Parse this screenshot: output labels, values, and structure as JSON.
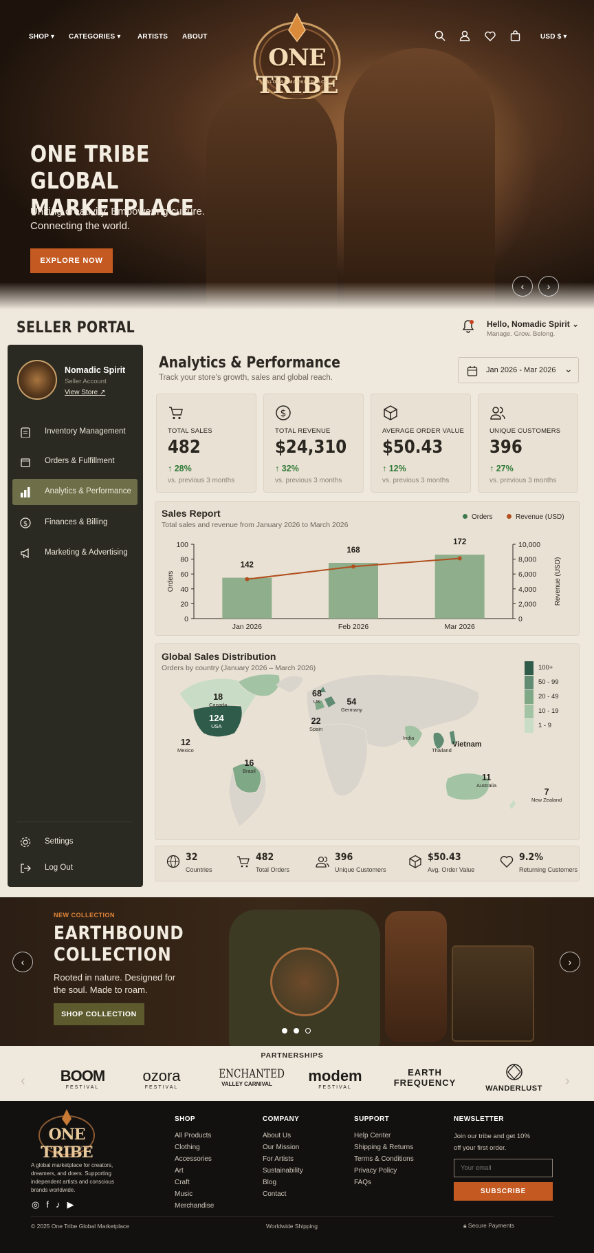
{
  "nav": {
    "shop": "SHOP",
    "categories": "CATEGORIES",
    "artists": "ARTISTS",
    "about": "ABOUT",
    "currency": "USD $"
  },
  "brand": {
    "logo_text": "ONE TRIBE",
    "logo_sub": "GLOBAL MARKETPLACE"
  },
  "hero": {
    "title_line1": "ONE TRIBE",
    "title_line2": "GLOBAL MARKETPLACE",
    "subtitle_line1": "Uniting creativity. Empowering culture.",
    "subtitle_line2": "Connecting the world.",
    "cta": "EXPLORE NOW"
  },
  "portal": {
    "title": "SELLER PORTAL",
    "greeting": "Hello, Nomadic Spirit",
    "tagline": "Manage. Grow. Belong."
  },
  "sidebar": {
    "profile": {
      "name": "Nomadic Spirit",
      "role": "Seller Account",
      "link": "View Store"
    },
    "items": [
      {
        "label": "Inventory Management",
        "icon": "clipboard-icon"
      },
      {
        "label": "Orders & Fulfillment",
        "icon": "box-icon"
      },
      {
        "label": "Analytics & Performance",
        "icon": "bar-chart-icon",
        "active": true
      },
      {
        "label": "Finances & Billing",
        "icon": "dollar-icon"
      },
      {
        "label": "Marketing & Advertising",
        "icon": "megaphone-icon"
      }
    ],
    "settings": "Settings",
    "logout": "Log Out"
  },
  "analytics": {
    "title": "Analytics & Performance",
    "subtitle": "Track your store's growth, sales and global reach.",
    "date_range": "Jan 2026 - Mar 2026",
    "stats": [
      {
        "label": "TOTAL SALES",
        "value": "482",
        "change": "28%",
        "compare": "vs. previous 3 months",
        "icon": "cart-icon"
      },
      {
        "label": "TOTAL REVENUE",
        "value": "$24,310",
        "change": "32%",
        "compare": "vs. previous 3 months",
        "icon": "dollar-icon"
      },
      {
        "label": "AVERAGE ORDER VALUE",
        "value": "$50.43",
        "change": "12%",
        "compare": "vs. previous 3 months",
        "icon": "package-icon"
      },
      {
        "label": "UNIQUE CUSTOMERS",
        "value": "396",
        "change": "27%",
        "compare": "vs. previous 3 months",
        "icon": "users-icon"
      }
    ]
  },
  "chart_data": {
    "type": "bar",
    "title": "Sales Report",
    "subtitle": "Total sales and revenue from January 2026 to March 2026",
    "categories": [
      "Jan 2026",
      "Feb 2026",
      "Mar 2026"
    ],
    "series": [
      {
        "name": "Orders",
        "type": "bar",
        "axis": "left",
        "values": [
          55,
          75,
          86
        ],
        "labels": [
          "142",
          "168",
          "172"
        ],
        "color": "#8fae8c"
      },
      {
        "name": "Revenue (USD)",
        "type": "line",
        "axis": "right",
        "values": [
          5300,
          7000,
          8100
        ],
        "color": "#b14f1e"
      }
    ],
    "ylabel": "Orders",
    "y2label": "Revenue (USD)",
    "ylim": [
      0,
      100
    ],
    "y2lim": [
      0,
      10000
    ],
    "yticks": [
      "0",
      "20",
      "40",
      "60",
      "80",
      "100"
    ],
    "y2ticks": [
      "0",
      "2,000",
      "4,000",
      "6,000",
      "8,000",
      "10,000"
    ],
    "legend": "top-right"
  },
  "map": {
    "title": "Global Sales Distribution",
    "subtitle": "Orders by country (January 2026 – March 2026)",
    "legend": [
      "100+",
      "50 - 99",
      "20 - 49",
      "10 - 19",
      "1 - 9"
    ],
    "legend_colors": [
      "#2f5b4b",
      "#5f8c73",
      "#7fa887",
      "#a3c3a5",
      "#c9dcc6"
    ],
    "countries": [
      {
        "value": "18",
        "name": "Canada"
      },
      {
        "value": "124",
        "name": "USA"
      },
      {
        "value": "12",
        "name": "Mexico"
      },
      {
        "value": "16",
        "name": "Brasil"
      },
      {
        "value": "68",
        "name": "UK"
      },
      {
        "value": "54",
        "name": "Germany"
      },
      {
        "value": "22",
        "name": "Spain"
      },
      {
        "value": "",
        "name": "India"
      },
      {
        "value": "",
        "name": "Thailand"
      },
      {
        "value": "",
        "name": "Vietnam"
      },
      {
        "value": "11",
        "name": "Australia"
      },
      {
        "value": "7",
        "name": "New Zealand"
      }
    ]
  },
  "summary": [
    {
      "value": "32",
      "label": "Countries",
      "icon": "globe-icon"
    },
    {
      "value": "482",
      "label": "Total Orders",
      "icon": "cart-icon"
    },
    {
      "value": "396",
      "label": "Unique Customers",
      "icon": "users-icon"
    },
    {
      "value": "$50.43",
      "label": "Avg. Order Value",
      "icon": "package-icon"
    },
    {
      "value": "9.2%",
      "label": "Returning Customers",
      "icon": "heart-icon"
    }
  ],
  "collection": {
    "tag": "NEW COLLECTION",
    "title_line1": "EARTHBOUND",
    "title_line2": "COLLECTION",
    "desc_line1": "Rooted in nature. Designed for",
    "desc_line2": "the soul. Made to roam.",
    "cta": "SHOP COLLECTION"
  },
  "partnerships": {
    "title": "PARTNERSHIPS",
    "logos": [
      {
        "main": "BOOM",
        "sub": "FESTIVAL"
      },
      {
        "main": "ozora",
        "sub": "FESTIVAL"
      },
      {
        "main": "ENCHANTED",
        "sub": "VALLEY CARNIVAL"
      },
      {
        "main": "modem",
        "sub": "FESTIVAL"
      },
      {
        "main": "EARTH",
        "sub": "FREQUENCY"
      },
      {
        "main": "",
        "sub": "WANDERLUST"
      }
    ]
  },
  "footer": {
    "logo_text": "ONE TRIBE",
    "logo_sub": "GLOBAL MARKETPLACE",
    "about_lines": [
      "A global marketplace for creators,",
      "dreamers, and doers. Supporting",
      "independent artists and conscious",
      "brands worldwide."
    ],
    "shop": {
      "title": "SHOP",
      "links": [
        "All Products",
        "Clothing",
        "Accessories",
        "Art",
        "Craft",
        "Music",
        "Merchandise"
      ]
    },
    "company": {
      "title": "COMPANY",
      "links": [
        "About Us",
        "Our Mission",
        "For Artists",
        "Sustainability",
        "Blog",
        "Contact"
      ]
    },
    "support": {
      "title": "SUPPORT",
      "links": [
        "Help Center",
        "Shipping & Returns",
        "Terms & Conditions",
        "Privacy Policy",
        "FAQs"
      ]
    },
    "newsletter": {
      "title": "NEWSLETTER",
      "text_line1": "Join our tribe and get 10%",
      "text_line2": "off your first order.",
      "placeholder": "Your email",
      "cta": "SUBSCRIBE"
    },
    "copyright": "© 2025 One Tribe Global Marketplace",
    "shipping": "Worldwide Shipping",
    "payments": "Secure Payments"
  }
}
